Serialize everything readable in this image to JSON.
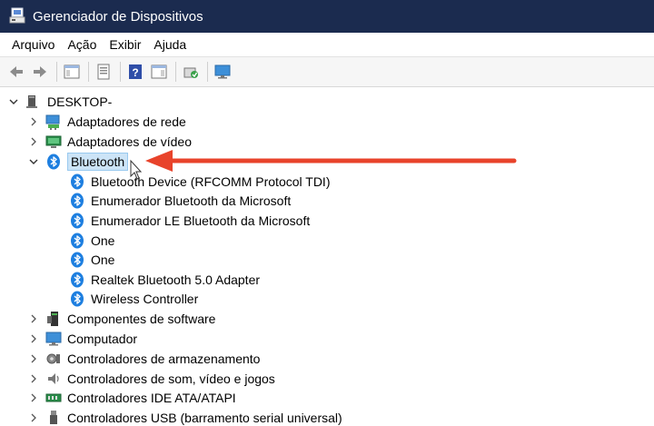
{
  "window": {
    "title": "Gerenciador de Dispositivos"
  },
  "menu": [
    "Arquivo",
    "Ação",
    "Exibir",
    "Ajuda"
  ],
  "tree": {
    "root": "DESKTOP-",
    "categories": [
      {
        "label": "Adaptadores de rede",
        "icon": "network-adapter-icon",
        "expanded": false
      },
      {
        "label": "Adaptadores de vídeo",
        "icon": "display-adapter-icon",
        "expanded": false
      },
      {
        "label": "Bluetooth",
        "icon": "bluetooth-icon",
        "expanded": true,
        "selected": true,
        "children": [
          "Bluetooth Device (RFCOMM Protocol TDI)",
          "Enumerador Bluetooth da Microsoft",
          "Enumerador LE Bluetooth da Microsoft",
          "One",
          "One",
          "Realtek Bluetooth 5.0 Adapter",
          "Wireless Controller"
        ]
      },
      {
        "label": "Componentes de software",
        "icon": "software-component-icon",
        "expanded": false
      },
      {
        "label": "Computador",
        "icon": "computer-icon",
        "expanded": false
      },
      {
        "label": "Controladores de armazenamento",
        "icon": "storage-controller-icon",
        "expanded": false
      },
      {
        "label": "Controladores de som, vídeo e jogos",
        "icon": "speaker-icon",
        "expanded": false
      },
      {
        "label": "Controladores IDE ATA/ATAPI",
        "icon": "ide-controller-icon",
        "expanded": false
      },
      {
        "label": "Controladores USB (barramento serial universal)",
        "icon": "usb-icon",
        "expanded": false
      }
    ]
  },
  "colors": {
    "titlebar": "#1b2b4f",
    "bluetooth": "#1e7fe0",
    "selection": "#cce4f7",
    "annotation_arrow": "#e8432b"
  }
}
